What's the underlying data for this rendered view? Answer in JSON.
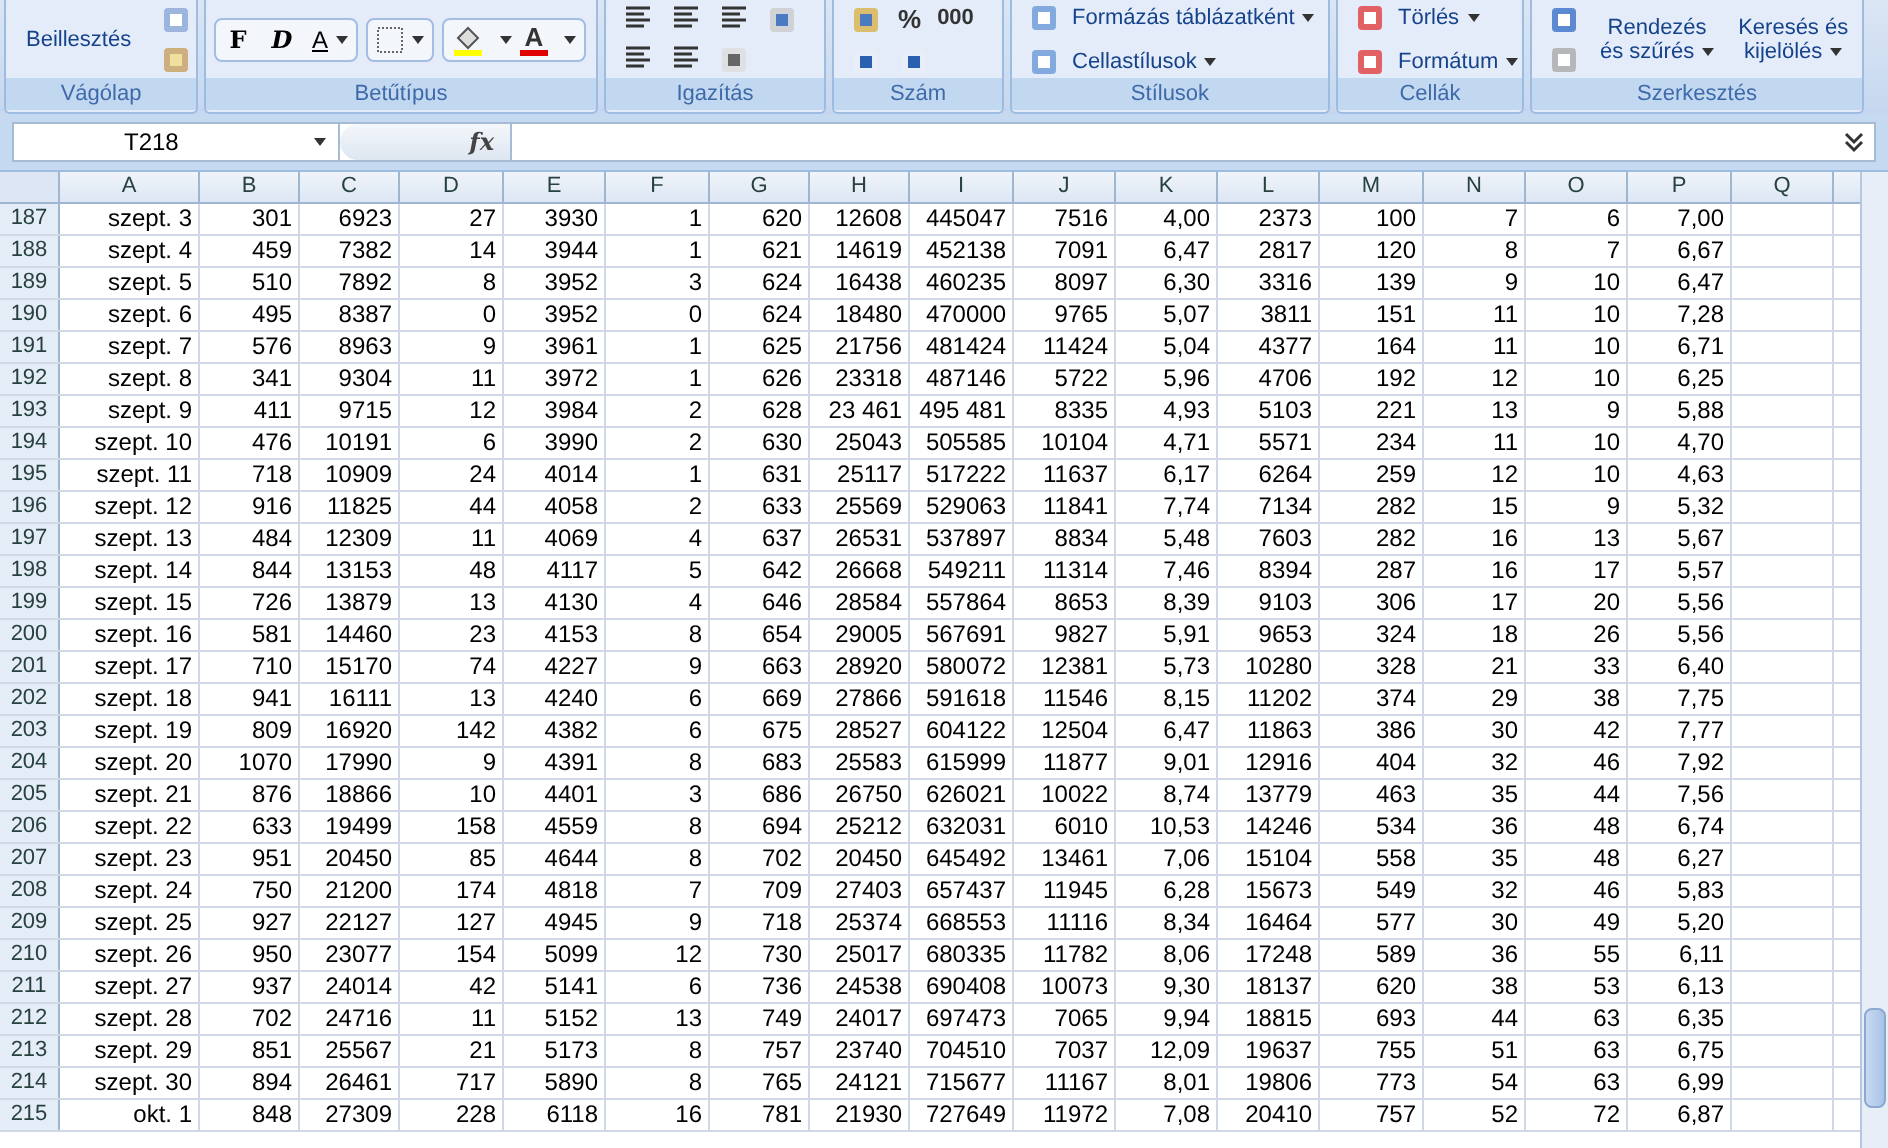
{
  "ribbon": {
    "groups": [
      {
        "label": "Vágólap",
        "buttons": [
          {
            "lines": [
              "Beillesztés"
            ]
          }
        ]
      },
      {
        "label": "Betűtípus",
        "buttons": [
          {
            "lines": [
              "F"
            ]
          },
          {
            "lines": [
              "D"
            ]
          },
          {
            "lines": [
              "A"
            ]
          },
          {
            "lines": [
              "A"
            ]
          }
        ]
      },
      {
        "label": "Igazítás"
      },
      {
        "label": "Szám",
        "buttons": [
          {
            "lines": [
              "%"
            ]
          },
          {
            "lines": [
              "000"
            ]
          }
        ]
      },
      {
        "label": "Stílusok",
        "buttons": [
          {
            "lines": [
              "Formázás táblázatként"
            ]
          },
          {
            "lines": [
              "Cellastílusok"
            ]
          }
        ]
      },
      {
        "label": "Cellák",
        "buttons": [
          {
            "lines": [
              "Törlés"
            ]
          },
          {
            "lines": [
              "Formátum"
            ]
          }
        ]
      },
      {
        "label": "Szerkesztés",
        "buttons": [
          {
            "lines": [
              "Rendezés",
              "és szűrés"
            ]
          },
          {
            "lines": [
              "Keresés és",
              "kijelölés"
            ]
          }
        ]
      }
    ]
  },
  "formula_bar": {
    "name_box": "T218",
    "fx": "fx"
  },
  "columns": [
    "A",
    "B",
    "C",
    "D",
    "E",
    "F",
    "G",
    "H",
    "I",
    "J",
    "K",
    "L",
    "M",
    "N",
    "O",
    "P",
    "Q"
  ],
  "rows": [
    {
      "number": "187",
      "cells": [
        "szept. 3",
        "301",
        "6923",
        "27",
        "3930",
        "1",
        "620",
        "12608",
        "445047",
        "7516",
        "4,00",
        "2373",
        "100",
        "7",
        "6",
        "7,00"
      ]
    },
    {
      "number": "188",
      "cells": [
        "szept. 4",
        "459",
        "7382",
        "14",
        "3944",
        "1",
        "621",
        "14619",
        "452138",
        "7091",
        "6,47",
        "2817",
        "120",
        "8",
        "7",
        "6,67"
      ]
    },
    {
      "number": "189",
      "cells": [
        "szept. 5",
        "510",
        "7892",
        "8",
        "3952",
        "3",
        "624",
        "16438",
        "460235",
        "8097",
        "6,30",
        "3316",
        "139",
        "9",
        "10",
        "6,47"
      ]
    },
    {
      "number": "190",
      "cells": [
        "szept. 6",
        "495",
        "8387",
        "0",
        "3952",
        "0",
        "624",
        "18480",
        "470000",
        "9765",
        "5,07",
        "3811",
        "151",
        "11",
        "10",
        "7,28"
      ]
    },
    {
      "number": "191",
      "cells": [
        "szept. 7",
        "576",
        "8963",
        "9",
        "3961",
        "1",
        "625",
        "21756",
        "481424",
        "11424",
        "5,04",
        "4377",
        "164",
        "11",
        "10",
        "6,71"
      ]
    },
    {
      "number": "192",
      "cells": [
        "szept. 8",
        "341",
        "9304",
        "11",
        "3972",
        "1",
        "626",
        "23318",
        "487146",
        "5722",
        "5,96",
        "4706",
        "192",
        "12",
        "10",
        "6,25"
      ]
    },
    {
      "number": "193",
      "cells": [
        "szept. 9",
        "411",
        "9715",
        "12",
        "3984",
        "2",
        "628",
        "23 461",
        "495 481",
        "8335",
        "4,93",
        "5103",
        "221",
        "13",
        "9",
        "5,88"
      ]
    },
    {
      "number": "194",
      "cells": [
        "szept. 10",
        "476",
        "10191",
        "6",
        "3990",
        "2",
        "630",
        "25043",
        "505585",
        "10104",
        "4,71",
        "5571",
        "234",
        "11",
        "10",
        "4,70"
      ]
    },
    {
      "number": "195",
      "cells": [
        "szept. 11",
        "718",
        "10909",
        "24",
        "4014",
        "1",
        "631",
        "25117",
        "517222",
        "11637",
        "6,17",
        "6264",
        "259",
        "12",
        "10",
        "4,63"
      ]
    },
    {
      "number": "196",
      "cells": [
        "szept. 12",
        "916",
        "11825",
        "44",
        "4058",
        "2",
        "633",
        "25569",
        "529063",
        "11841",
        "7,74",
        "7134",
        "282",
        "15",
        "9",
        "5,32"
      ]
    },
    {
      "number": "197",
      "cells": [
        "szept. 13",
        "484",
        "12309",
        "11",
        "4069",
        "4",
        "637",
        "26531",
        "537897",
        "8834",
        "5,48",
        "7603",
        "282",
        "16",
        "13",
        "5,67"
      ]
    },
    {
      "number": "198",
      "cells": [
        "szept. 14",
        "844",
        "13153",
        "48",
        "4117",
        "5",
        "642",
        "26668",
        "549211",
        "11314",
        "7,46",
        "8394",
        "287",
        "16",
        "17",
        "5,57"
      ]
    },
    {
      "number": "199",
      "cells": [
        "szept. 15",
        "726",
        "13879",
        "13",
        "4130",
        "4",
        "646",
        "28584",
        "557864",
        "8653",
        "8,39",
        "9103",
        "306",
        "17",
        "20",
        "5,56"
      ]
    },
    {
      "number": "200",
      "cells": [
        "szept. 16",
        "581",
        "14460",
        "23",
        "4153",
        "8",
        "654",
        "29005",
        "567691",
        "9827",
        "5,91",
        "9653",
        "324",
        "18",
        "26",
        "5,56"
      ]
    },
    {
      "number": "201",
      "cells": [
        "szept. 17",
        "710",
        "15170",
        "74",
        "4227",
        "9",
        "663",
        "28920",
        "580072",
        "12381",
        "5,73",
        "10280",
        "328",
        "21",
        "33",
        "6,40"
      ]
    },
    {
      "number": "202",
      "cells": [
        "szept. 18",
        "941",
        "16111",
        "13",
        "4240",
        "6",
        "669",
        "27866",
        "591618",
        "11546",
        "8,15",
        "11202",
        "374",
        "29",
        "38",
        "7,75"
      ]
    },
    {
      "number": "203",
      "cells": [
        "szept. 19",
        "809",
        "16920",
        "142",
        "4382",
        "6",
        "675",
        "28527",
        "604122",
        "12504",
        "6,47",
        "11863",
        "386",
        "30",
        "42",
        "7,77"
      ]
    },
    {
      "number": "204",
      "cells": [
        "szept. 20",
        "1070",
        "17990",
        "9",
        "4391",
        "8",
        "683",
        "25583",
        "615999",
        "11877",
        "9,01",
        "12916",
        "404",
        "32",
        "46",
        "7,92"
      ]
    },
    {
      "number": "205",
      "cells": [
        "szept. 21",
        "876",
        "18866",
        "10",
        "4401",
        "3",
        "686",
        "26750",
        "626021",
        "10022",
        "8,74",
        "13779",
        "463",
        "35",
        "44",
        "7,56"
      ]
    },
    {
      "number": "206",
      "cells": [
        "szept. 22",
        "633",
        "19499",
        "158",
        "4559",
        "8",
        "694",
        "25212",
        "632031",
        "6010",
        "10,53",
        "14246",
        "534",
        "36",
        "48",
        "6,74"
      ]
    },
    {
      "number": "207",
      "cells": [
        "szept. 23",
        "951",
        "20450",
        "85",
        "4644",
        "8",
        "702",
        "20450",
        "645492",
        "13461",
        "7,06",
        "15104",
        "558",
        "35",
        "48",
        "6,27"
      ]
    },
    {
      "number": "208",
      "cells": [
        "szept. 24",
        "750",
        "21200",
        "174",
        "4818",
        "7",
        "709",
        "27403",
        "657437",
        "11945",
        "6,28",
        "15673",
        "549",
        "32",
        "46",
        "5,83"
      ]
    },
    {
      "number": "209",
      "cells": [
        "szept. 25",
        "927",
        "22127",
        "127",
        "4945",
        "9",
        "718",
        "25374",
        "668553",
        "11116",
        "8,34",
        "16464",
        "577",
        "30",
        "49",
        "5,20"
      ]
    },
    {
      "number": "210",
      "cells": [
        "szept. 26",
        "950",
        "23077",
        "154",
        "5099",
        "12",
        "730",
        "25017",
        "680335",
        "11782",
        "8,06",
        "17248",
        "589",
        "36",
        "55",
        "6,11"
      ]
    },
    {
      "number": "211",
      "cells": [
        "szept. 27",
        "937",
        "24014",
        "42",
        "5141",
        "6",
        "736",
        "24538",
        "690408",
        "10073",
        "9,30",
        "18137",
        "620",
        "38",
        "53",
        "6,13"
      ]
    },
    {
      "number": "212",
      "cells": [
        "szept. 28",
        "702",
        "24716",
        "11",
        "5152",
        "13",
        "749",
        "24017",
        "697473",
        "7065",
        "9,94",
        "18815",
        "693",
        "44",
        "63",
        "6,35"
      ]
    },
    {
      "number": "213",
      "cells": [
        "szept. 29",
        "851",
        "25567",
        "21",
        "5173",
        "8",
        "757",
        "23740",
        "704510",
        "7037",
        "12,09",
        "19637",
        "755",
        "51",
        "63",
        "6,75"
      ]
    },
    {
      "number": "214",
      "cells": [
        "szept. 30",
        "894",
        "26461",
        "717",
        "5890",
        "8",
        "765",
        "24121",
        "715677",
        "11167",
        "8,01",
        "19806",
        "773",
        "54",
        "63",
        "6,99"
      ]
    },
    {
      "number": "215",
      "cells": [
        "okt. 1",
        "848",
        "27309",
        "228",
        "6118",
        "16",
        "781",
        "21930",
        "727649",
        "11972",
        "7,08",
        "20410",
        "757",
        "52",
        "72",
        "6,87"
      ]
    }
  ]
}
